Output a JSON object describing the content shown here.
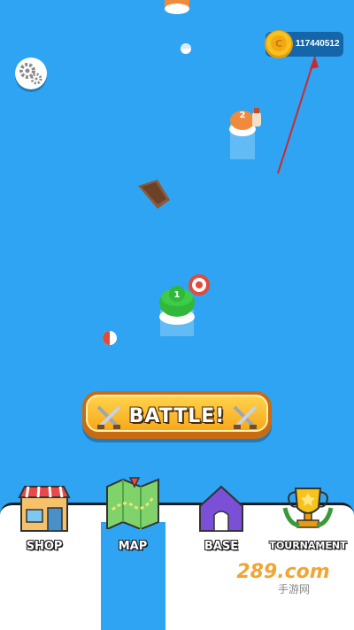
{
  "hud": {
    "coins": "117440512"
  },
  "map": {
    "level_markers": [
      "1",
      "2"
    ]
  },
  "battle": {
    "label": "BATTLE!"
  },
  "nav": {
    "items": [
      {
        "label": "SHOP"
      },
      {
        "label": "MAP"
      },
      {
        "label": "BASE"
      },
      {
        "label": "TOURNAMENT"
      }
    ],
    "active": "MAP"
  },
  "watermark": {
    "brand": "289.com",
    "sub": "手游网"
  },
  "colors": {
    "sea": "#2ea4f2",
    "button_gold": "#f7a91c",
    "island_green": "#2fb83a",
    "island_orange": "#f08a3c"
  }
}
